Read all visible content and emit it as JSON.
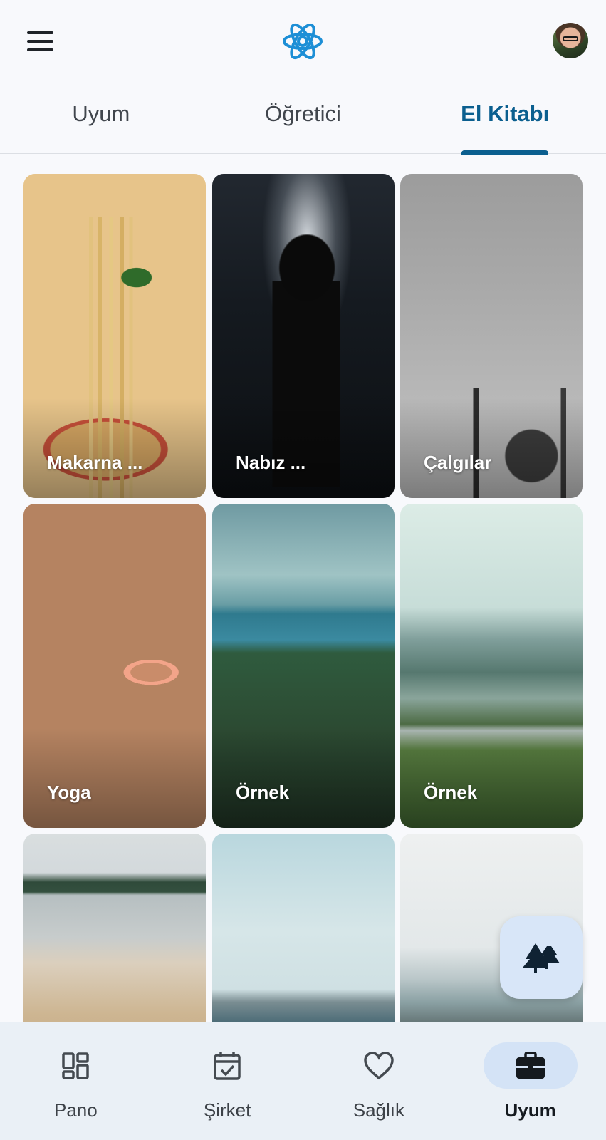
{
  "header": {
    "menu_icon": "menu-icon",
    "logo_icon": "atom-logo-icon",
    "avatar_icon": "user-avatar"
  },
  "tabs": [
    {
      "label": "Uyum",
      "active": false
    },
    {
      "label": "Öğretici",
      "active": false
    },
    {
      "label": "El Kitabı",
      "active": true
    }
  ],
  "cards": [
    {
      "label": "Makarna ...",
      "image": "pasta"
    },
    {
      "label": "Nabız ...",
      "image": "silhouette-light"
    },
    {
      "label": "Çalgılar",
      "image": "instruments"
    },
    {
      "label": "Yoga",
      "image": "yoga-candle"
    },
    {
      "label": "Örnek",
      "image": "lake-forest"
    },
    {
      "label": "Örnek",
      "image": "river-hills"
    },
    {
      "label": "",
      "image": "beach"
    },
    {
      "label": "",
      "image": "sea"
    },
    {
      "label": "",
      "image": "coast"
    }
  ],
  "fab": {
    "icon": "trees-icon"
  },
  "bottom_nav": [
    {
      "label": "Pano",
      "icon": "dashboard-icon",
      "active": false
    },
    {
      "label": "Şirket",
      "icon": "calendar-check-icon",
      "active": false
    },
    {
      "label": "Sağlık",
      "icon": "heart-icon",
      "active": false
    },
    {
      "label": "Uyum",
      "icon": "briefcase-icon",
      "active": true
    }
  ],
  "colors": {
    "accent": "#0b5f8f",
    "logo": "#1d8fd6",
    "nav_background": "#eaf0f6",
    "active_pill": "#d4e3f6",
    "fab_background": "#d8e6f8"
  }
}
